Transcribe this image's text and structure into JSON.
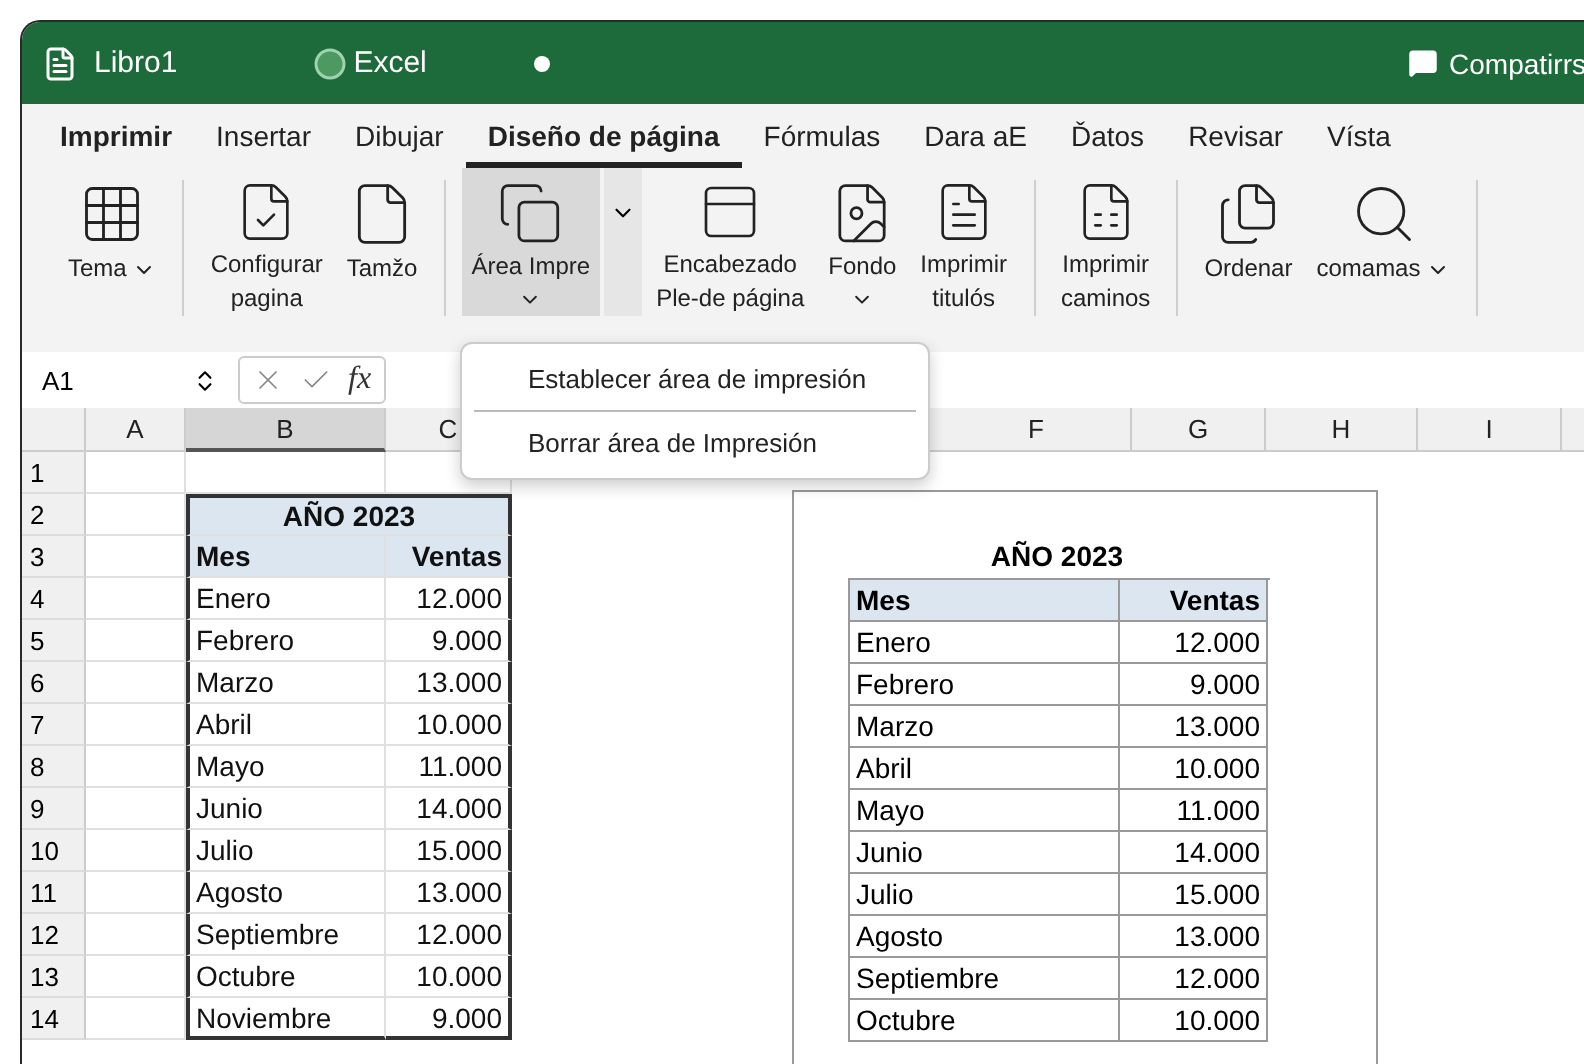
{
  "window": {
    "title": "Libro1",
    "app_name": "Excel",
    "share_label": "Compatirrs"
  },
  "tabs": [
    {
      "label": "Imprimir",
      "kind": "file",
      "selected": false
    },
    {
      "label": "Insertar",
      "kind": "tab",
      "selected": false
    },
    {
      "label": "Dibujar",
      "kind": "tab",
      "selected": false
    },
    {
      "label": "Diseño de página",
      "kind": "tab",
      "selected": true
    },
    {
      "label": "Fórmulas",
      "kind": "tab",
      "selected": false
    },
    {
      "label": "Dara aE",
      "kind": "tab",
      "selected": false
    },
    {
      "label": "Ďatos",
      "kind": "tab",
      "selected": false
    },
    {
      "label": "Revisar",
      "kind": "tab",
      "selected": false
    },
    {
      "label": "Vísta",
      "kind": "tab",
      "selected": false
    }
  ],
  "ribbon": [
    {
      "buttons": [
        {
          "lines": [
            "Tema"
          ],
          "kind": "dropdown",
          "pressed": false
        }
      ]
    },
    {
      "buttons": [
        {
          "lines": [
            "Configurar",
            "pagina"
          ],
          "kind": "plain",
          "pressed": false
        },
        {
          "lines": [
            "Tamžo"
          ],
          "kind": "plain",
          "pressed": false
        }
      ]
    },
    {
      "buttons": [
        {
          "lines": [
            "Área Impre"
          ],
          "kind": "split",
          "pressed": true
        },
        {
          "lines": [
            "Encabezado",
            "Ple-de página"
          ],
          "kind": "plain",
          "pressed": false
        },
        {
          "lines": [
            "Fondo"
          ],
          "kind": "stacked",
          "pressed": false
        },
        {
          "lines": [
            "Imprimir",
            "titulós"
          ],
          "kind": "plain",
          "pressed": false
        }
      ]
    },
    {
      "buttons": [
        {
          "lines": [
            "Imprimir",
            "caminos"
          ],
          "kind": "plain",
          "pressed": false
        }
      ]
    },
    {
      "buttons": [
        {
          "lines": [
            "Ordenar"
          ],
          "kind": "plain",
          "pressed": false
        },
        {
          "lines": [
            "comamas"
          ],
          "kind": "dropdown",
          "pressed": false
        }
      ]
    }
  ],
  "formula_bar": {
    "name_box": "A1",
    "function_label": "fx"
  },
  "print_area_menu": [
    {
      "label": "Establecer área de impresión"
    },
    {
      "label": "Borrar área de Impresión"
    }
  ],
  "sheet": {
    "columns": [
      {
        "label": "A",
        "selected": false
      },
      {
        "label": "B",
        "selected": true
      },
      {
        "label": "C",
        "selected": false
      }
    ],
    "right_columns": [
      {
        "label": "F",
        "selected": false
      },
      {
        "label": "G",
        "selected": false
      },
      {
        "label": "H",
        "selected": false
      },
      {
        "label": "I",
        "selected": false
      }
    ],
    "row_numbers": [
      "1",
      "2",
      "3",
      "4",
      "5",
      "6",
      "7",
      "8",
      "9",
      "10",
      "11",
      "12",
      "13",
      "14"
    ],
    "table": {
      "title": "AÑO 2023",
      "headers": [
        "Mes",
        "Ventas"
      ],
      "rows": [
        [
          "Enero",
          "12.000"
        ],
        [
          "Febrero",
          "9.000"
        ],
        [
          "Marzo",
          "13.000"
        ],
        [
          "Abril",
          "10.000"
        ],
        [
          "Mayo",
          "11.000"
        ],
        [
          "Junio",
          "14.000"
        ],
        [
          "Julio",
          "15.000"
        ],
        [
          "Agosto",
          "13.000"
        ],
        [
          "Septiembre",
          "12.000"
        ],
        [
          "Octubre",
          "10.000"
        ],
        [
          "Noviembre",
          "9.000"
        ]
      ]
    }
  },
  "page_preview": {
    "title": "AÑO 2023",
    "headers": [
      "Mes",
      "Ventas"
    ],
    "rows": [
      [
        "Enero",
        "12.000"
      ],
      [
        "Febrero",
        "9.000"
      ],
      [
        "Marzo",
        "13.000"
      ],
      [
        "Abril",
        "10.000"
      ],
      [
        "Mayo",
        "11.000"
      ],
      [
        "Junio",
        "14.000"
      ],
      [
        "Julio",
        "15.000"
      ],
      [
        "Agosto",
        "13.000"
      ],
      [
        "Septiembre",
        "12.000"
      ],
      [
        "Octubre",
        "10.000"
      ]
    ]
  }
}
